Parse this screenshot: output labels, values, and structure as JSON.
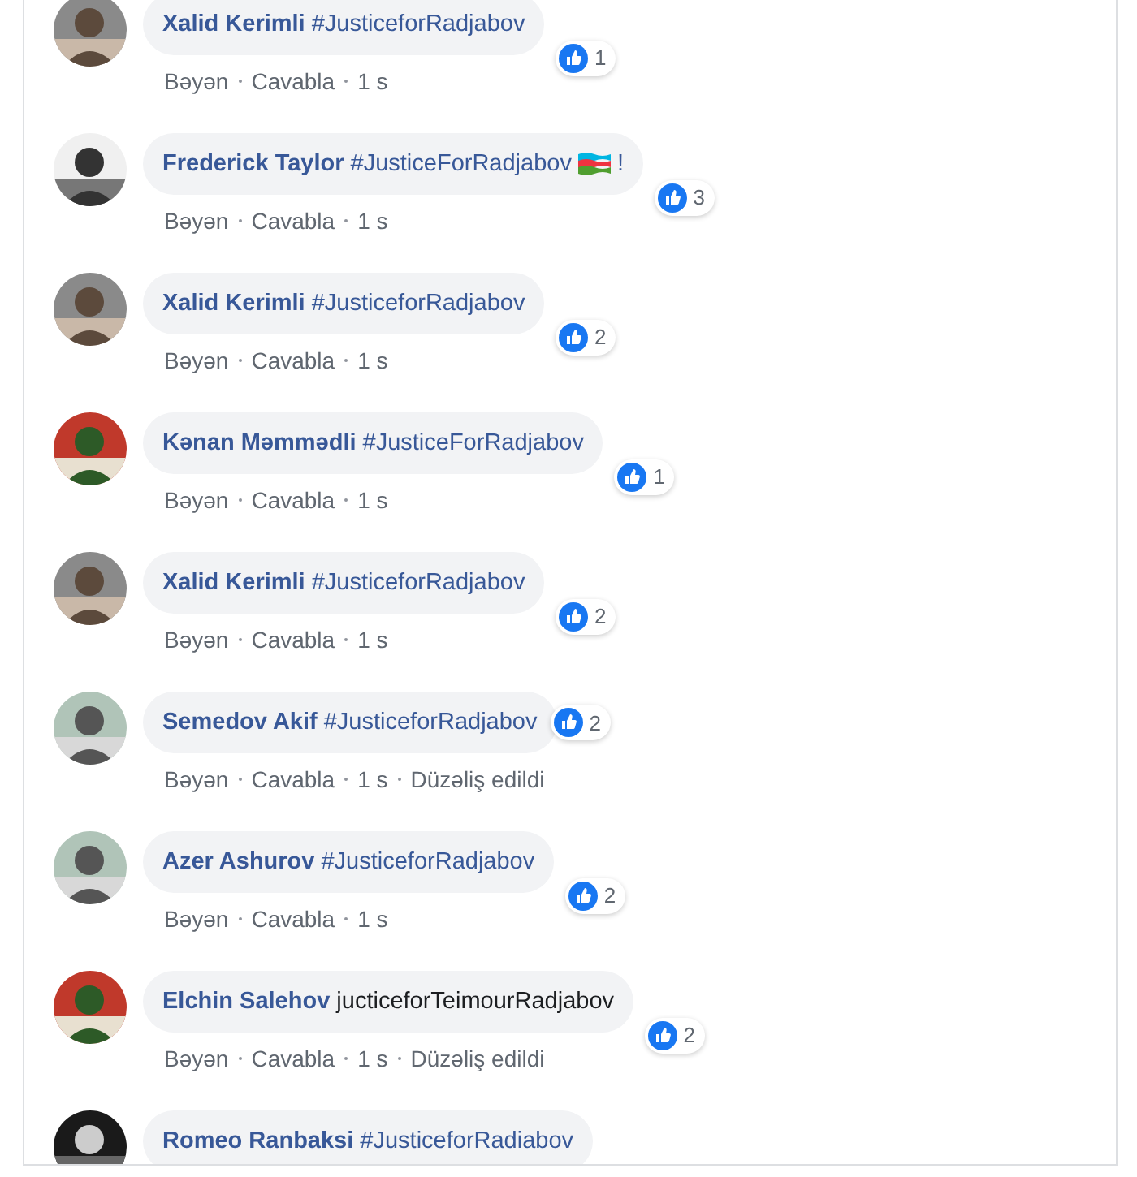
{
  "comments": [
    {
      "author": "Xalid Kerimli",
      "text": "#JusticeforRadjabov",
      "kind": "hashtag",
      "reactions": "1",
      "reaction_beside": false,
      "meta": [
        "Bəyən",
        "Cavabla",
        "1 s"
      ]
    },
    {
      "author": "Frederick Taylor",
      "text": "#JusticeForRadjabov",
      "kind": "hashtag",
      "flag": true,
      "suffix": "!",
      "reactions": "3",
      "reaction_beside": false,
      "meta": [
        "Bəyən",
        "Cavabla",
        "1 s"
      ]
    },
    {
      "author": "Xalid Kerimli",
      "text": "#JusticeforRadjabov",
      "kind": "hashtag",
      "reactions": "2",
      "reaction_beside": false,
      "meta": [
        "Bəyən",
        "Cavabla",
        "1 s"
      ]
    },
    {
      "author": "Kənan Məmmədli",
      "text": "#JusticeForRadjabov",
      "kind": "hashtag",
      "reactions": "1",
      "reaction_beside": false,
      "meta": [
        "Bəyən",
        "Cavabla",
        "1 s"
      ]
    },
    {
      "author": "Xalid Kerimli",
      "text": "#JusticeforRadjabov",
      "kind": "hashtag",
      "reactions": "2",
      "reaction_beside": false,
      "meta": [
        "Bəyən",
        "Cavabla",
        "1 s"
      ]
    },
    {
      "author": "Semedov Akif",
      "text": "#JusticeforRadjabov",
      "kind": "hashtag",
      "reactions": "2",
      "reaction_beside": true,
      "meta": [
        "Bəyən",
        "Cavabla",
        "1 s",
        "Düzəliş edildi"
      ]
    },
    {
      "author": "Azer Ashurov",
      "text": "#JusticeforRadjabov",
      "kind": "hashtag",
      "reactions": "2",
      "reaction_beside": false,
      "meta": [
        "Bəyən",
        "Cavabla",
        "1 s"
      ]
    },
    {
      "author": "Elchin Salehov",
      "text": "jucticeforTeimourRadjabov",
      "kind": "plain",
      "reactions": "2",
      "reaction_beside": false,
      "meta": [
        "Bəyən",
        "Cavabla",
        "1 s",
        "Düzəliş edildi"
      ]
    },
    {
      "author": "Romeo Ranbaksi",
      "text": "#JusticeforRadiabov",
      "kind": "hashtag"
    }
  ]
}
